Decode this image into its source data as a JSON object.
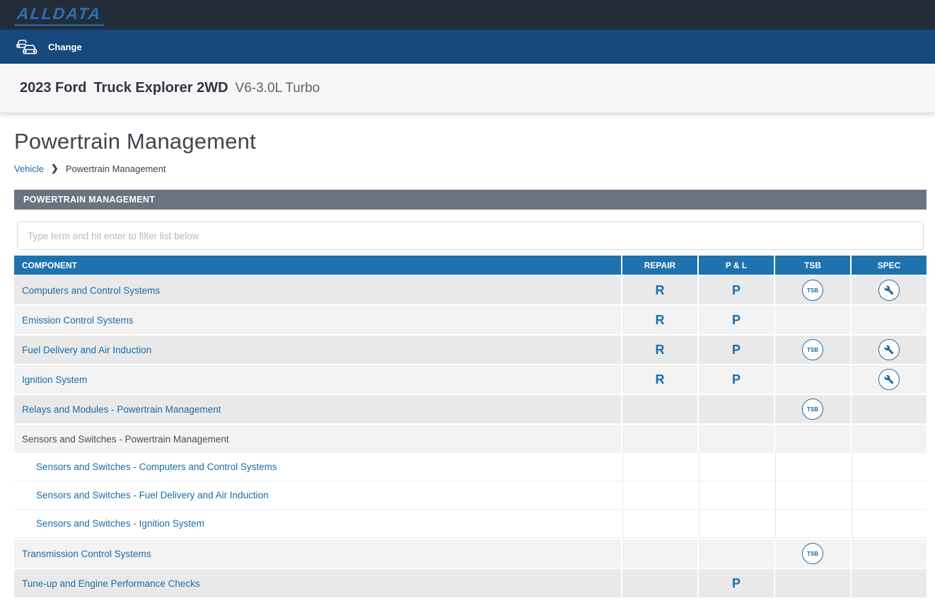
{
  "header": {
    "logo_text": "ALLDATA"
  },
  "change_bar": {
    "label": "Change",
    "icon": "vehicle-change-two-cars"
  },
  "vehicle_bar": {
    "year_make": "2023 Ford",
    "model": "Truck Explorer 2WD",
    "engine": "V6-3.0L Turbo"
  },
  "page": {
    "title": "Powertrain Management",
    "breadcrumb": {
      "root": "Vehicle",
      "separator": "❯",
      "current": "Powertrain Management"
    }
  },
  "section": {
    "header_label": "POWERTRAIN MANAGEMENT"
  },
  "filter": {
    "placeholder": "Type term and hit enter to filter list below",
    "value": ""
  },
  "table": {
    "columns": [
      "COMPONENT",
      "REPAIR",
      "P & L",
      "TSB",
      "SPEC"
    ],
    "repair_indicator": "R",
    "pl_indicator": "P",
    "tsb_badge_label": "TSB",
    "spec_icon": "wrench",
    "rows": [
      {
        "label": "Computers and Control Systems",
        "link": true,
        "indent": false,
        "shade": "a",
        "repair": true,
        "pl": true,
        "tsb": true,
        "spec": true
      },
      {
        "label": "Emission Control Systems",
        "link": true,
        "indent": false,
        "shade": "b",
        "repair": true,
        "pl": true,
        "tsb": false,
        "spec": false
      },
      {
        "label": "Fuel Delivery and Air Induction",
        "link": true,
        "indent": false,
        "shade": "a",
        "repair": true,
        "pl": true,
        "tsb": true,
        "spec": true
      },
      {
        "label": "Ignition System",
        "link": true,
        "indent": false,
        "shade": "b",
        "repair": true,
        "pl": true,
        "tsb": false,
        "spec": true
      },
      {
        "label": "Relays and Modules - Powertrain Management",
        "link": true,
        "indent": false,
        "shade": "a",
        "repair": false,
        "pl": false,
        "tsb": true,
        "spec": false
      },
      {
        "label": "Sensors and Switches - Powertrain Management",
        "link": false,
        "indent": false,
        "shade": "b",
        "repair": false,
        "pl": false,
        "tsb": false,
        "spec": false
      },
      {
        "label": "Sensors and Switches - Computers and Control Systems",
        "link": true,
        "indent": true,
        "shade": "white",
        "repair": false,
        "pl": false,
        "tsb": false,
        "spec": false
      },
      {
        "label": "Sensors and Switches - Fuel Delivery and Air Induction",
        "link": true,
        "indent": true,
        "shade": "white",
        "repair": false,
        "pl": false,
        "tsb": false,
        "spec": false
      },
      {
        "label": "Sensors and Switches - Ignition System",
        "link": true,
        "indent": true,
        "shade": "white",
        "repair": false,
        "pl": false,
        "tsb": false,
        "spec": false
      },
      {
        "label": "Transmission Control Systems",
        "link": true,
        "indent": false,
        "shade": "b",
        "repair": false,
        "pl": false,
        "tsb": true,
        "spec": false
      },
      {
        "label": "Tune-up and Engine Performance Checks",
        "link": true,
        "indent": false,
        "shade": "a",
        "repair": false,
        "pl": true,
        "tsb": false,
        "spec": false
      }
    ]
  },
  "colors": {
    "top_bar": "#232d3a",
    "change_bar": "#17497c",
    "logo_blue": "#2e6db4",
    "link_blue": "#1b6ca8",
    "table_header_blue": "#1e73ae",
    "section_bar_gray": "#6a7480",
    "row_shade_dark": "#e9e9e9",
    "row_shade_light": "#f3f3f3"
  }
}
